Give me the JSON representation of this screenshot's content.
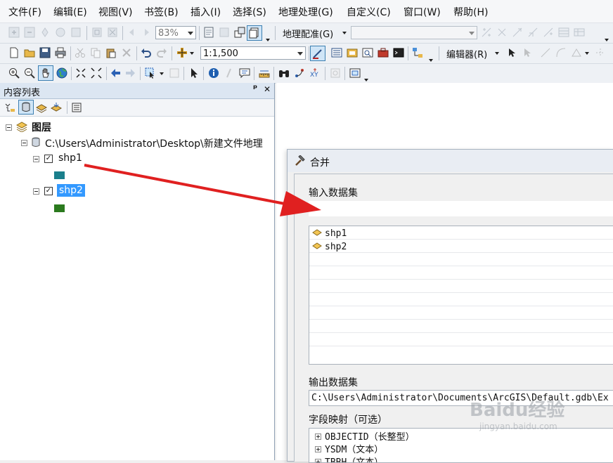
{
  "menu": [
    "文件(F)",
    "编辑(E)",
    "视图(V)",
    "书签(B)",
    "插入(I)",
    "选择(S)",
    "地理处理(G)",
    "自定义(C)",
    "窗口(W)",
    "帮助(H)"
  ],
  "toolbar": {
    "zoom_value": "83%",
    "georef_label": "地理配准(G)",
    "georef_layer_value": "",
    "scale_value": "1:1,500",
    "editor_label": "编辑器(R)"
  },
  "toc": {
    "title": "内容列表",
    "pin_glyph": "ᵖ",
    "close_glyph": "✕",
    "root_label": "图层",
    "path_label": "C:\\Users\\Administrator\\Desktop\\新建文件地理",
    "layers": [
      {
        "name": "shp1",
        "checked": true,
        "color": "#1a7f8c"
      },
      {
        "name": "shp2",
        "checked": true,
        "color": "#2b7a1e",
        "selected": true
      }
    ]
  },
  "dialog": {
    "title": "合并",
    "input_label": "输入数据集",
    "input_value": "",
    "input_list": [
      "shp1",
      "shp2"
    ],
    "output_label": "输出数据集",
    "output_value": "C:\\Users\\Administrator\\Documents\\ArcGIS\\Default.gdb\\Ex",
    "field_map_label": "字段映射（可选）",
    "fields": [
      "OBJECTID（长整型）",
      "YSDM（文本）",
      "TBBH（文本）"
    ]
  },
  "colors": {
    "arrow": "#e02020",
    "selection": "#3399ff",
    "shp1": "#1a7f8c",
    "shp2": "#2b7a1e"
  },
  "watermark": {
    "brand": "Baidu经验",
    "url": "jingyan.baidu.com"
  }
}
